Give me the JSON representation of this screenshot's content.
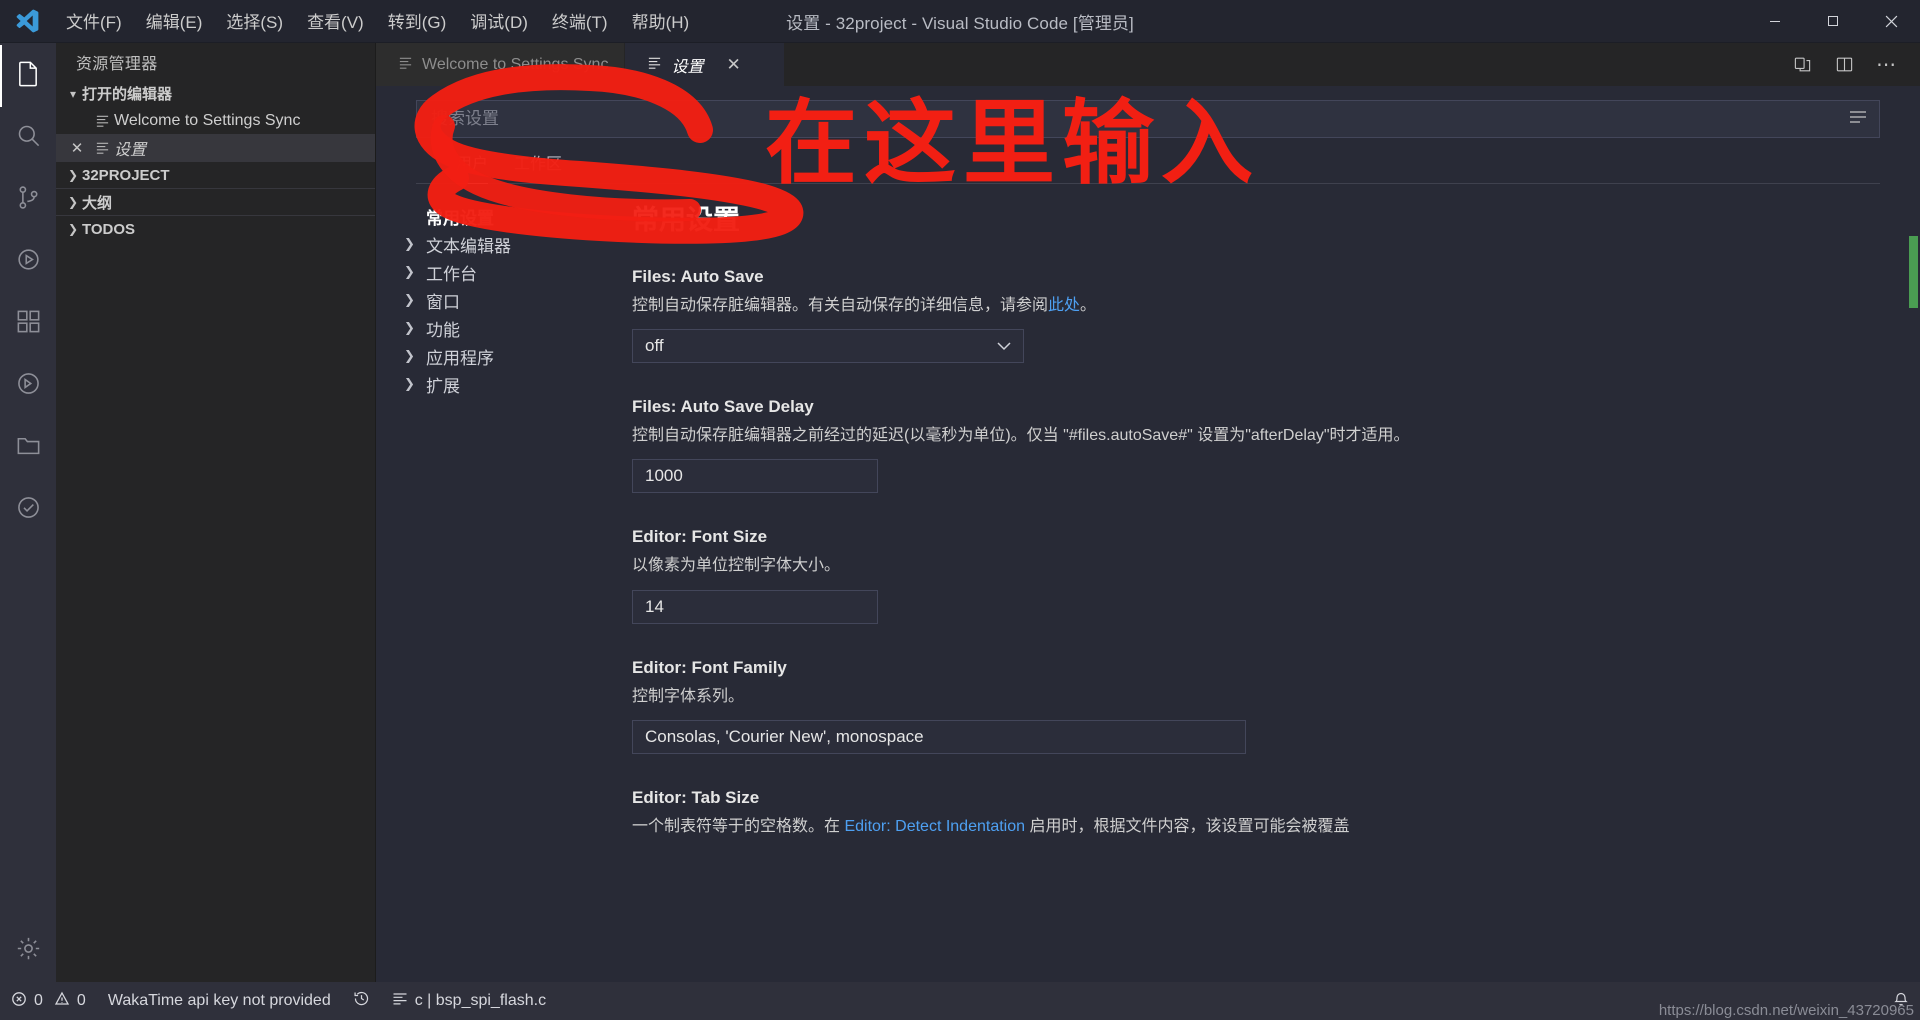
{
  "window": {
    "title": "设置 - 32project - Visual Studio Code [管理员]",
    "minimize_label": "最小化",
    "maximize_label": "最大化",
    "close_label": "关闭"
  },
  "menubar": {
    "items": [
      {
        "label": "文件(F)"
      },
      {
        "label": "编辑(E)"
      },
      {
        "label": "选择(S)"
      },
      {
        "label": "查看(V)"
      },
      {
        "label": "转到(G)"
      },
      {
        "label": "调试(D)"
      },
      {
        "label": "终端(T)"
      },
      {
        "label": "帮助(H)"
      }
    ]
  },
  "activitybar": {
    "items": [
      {
        "name": "explorer",
        "icon": "files-icon",
        "active": true
      },
      {
        "name": "search",
        "icon": "search-icon",
        "active": false
      },
      {
        "name": "source-control",
        "icon": "source-control-icon",
        "active": false
      },
      {
        "name": "debug",
        "icon": "debug-icon",
        "active": false
      },
      {
        "name": "extensions",
        "icon": "extensions-icon",
        "active": false
      },
      {
        "name": "remote",
        "icon": "remote-icon",
        "active": false
      },
      {
        "name": "project-manager",
        "icon": "folder-icon",
        "active": false
      },
      {
        "name": "todo-tree",
        "icon": "checklist-icon",
        "active": false
      },
      {
        "name": "manage",
        "icon": "gear-icon",
        "active": false
      }
    ]
  },
  "sidebar": {
    "title": "资源管理器",
    "sections": [
      {
        "label": "打开的编辑器",
        "expanded": true,
        "chevron": "▾"
      },
      {
        "label": "32PROJECT",
        "expanded": false,
        "chevron": "❯"
      },
      {
        "label": "大纲",
        "expanded": false,
        "chevron": "❯"
      },
      {
        "label": "TODOS",
        "expanded": false,
        "chevron": "❯"
      }
    ],
    "open_editors": [
      {
        "label": "Welcome to Settings Sync",
        "italic": false,
        "selected": false,
        "has_close": false
      },
      {
        "label": "设置",
        "italic": true,
        "selected": true,
        "has_close": true,
        "close_glyph": "✕"
      }
    ]
  },
  "tabs": [
    {
      "label": "Welcome to Settings Sync",
      "active": false,
      "italic": false,
      "has_close": false
    },
    {
      "label": "设置",
      "active": true,
      "italic": true,
      "has_close": true,
      "close_glyph": "✕"
    }
  ],
  "tab_actions": [
    {
      "name": "open-changes-icon",
      "glyph": "⧉"
    },
    {
      "name": "split-editor-icon",
      "glyph": "▤"
    },
    {
      "name": "more-actions-icon",
      "glyph": "⋯"
    }
  ],
  "settings": {
    "search_placeholder": "搜索设置",
    "search_value": "",
    "filter_icon": "filter-icon",
    "scope_tabs": [
      {
        "label": "用户",
        "active": true
      },
      {
        "label": "工作区",
        "active": false
      }
    ],
    "toc": [
      {
        "label": "常用设置",
        "header": true
      },
      {
        "label": "文本编辑器",
        "header": false,
        "chevron": "❯"
      },
      {
        "label": "工作台",
        "header": false,
        "chevron": "❯"
      },
      {
        "label": "窗口",
        "header": false,
        "chevron": "❯"
      },
      {
        "label": "功能",
        "header": false,
        "chevron": "❯"
      },
      {
        "label": "应用程序",
        "header": false,
        "chevron": "❯"
      },
      {
        "label": "扩展",
        "header": false,
        "chevron": "❯"
      }
    ],
    "section_title": "常用设置",
    "items": [
      {
        "key": "Files: Auto Save",
        "desc_before": "控制自动保存脏编辑器。有关自动保存的详细信息，请参阅",
        "desc_link": "此处",
        "desc_after": "。",
        "control": "select",
        "value": "off",
        "chevron": "⌄"
      },
      {
        "key": "Files: Auto Save Delay",
        "desc_before": "控制自动保存脏编辑器之前经过的延迟(以毫秒为单位)。仅当 \"#files.autoSave#\" 设置为\"afterDelay\"时才适用。",
        "desc_link": "",
        "desc_after": "",
        "control": "input",
        "value": "1000"
      },
      {
        "key": "Editor: Font Size",
        "desc_before": "以像素为单位控制字体大小。",
        "desc_link": "",
        "desc_after": "",
        "control": "input",
        "value": "14"
      },
      {
        "key": "Editor: Font Family",
        "desc_before": "控制字体系列。",
        "desc_link": "",
        "desc_after": "",
        "control": "input-wide",
        "value": "Consolas, 'Courier New', monospace"
      },
      {
        "key": "Editor: Tab Size",
        "desc_before": "一个制表符等于的空格数。在 ",
        "desc_link": "Editor: Detect Indentation",
        "desc_after": " 启用时，根据文件内容，该设置可能会被覆盖",
        "control": "none",
        "value": ""
      }
    ]
  },
  "annotation": {
    "text": "在这里输入",
    "color": "#f21f13",
    "shape": "circle-around-search-box"
  },
  "statusbar": {
    "left": [
      {
        "name": "problems",
        "icon": "error-warning",
        "label": "0  0",
        "errors": "0",
        "warnings": "0"
      },
      {
        "name": "wakatime",
        "icon": "",
        "label": "WakaTime api key not provided"
      },
      {
        "name": "history",
        "icon": "history-icon",
        "label": ""
      },
      {
        "name": "file-info",
        "icon": "list-icon",
        "label": "c | bsp_spi_flash.c"
      }
    ],
    "right": [
      {
        "name": "bell",
        "icon": "bell-icon",
        "label": ""
      }
    ]
  },
  "watermark": "https://blog.csdn.net/weixin_43720965"
}
